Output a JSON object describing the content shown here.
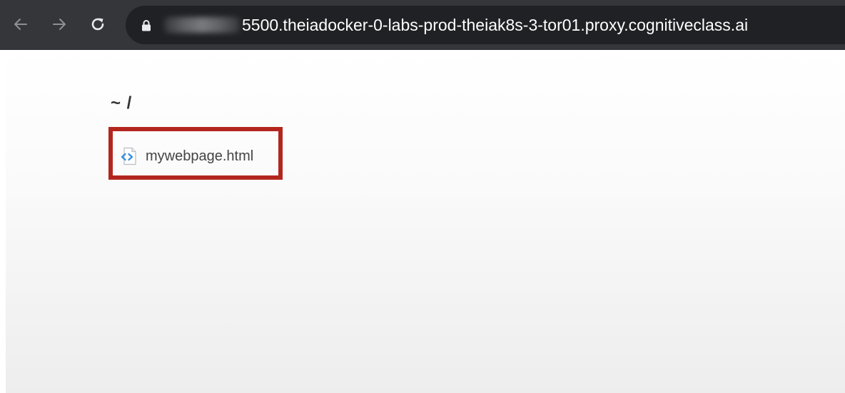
{
  "browser": {
    "url_visible": "5500.theiadocker-0-labs-prod-theiak8s-3-tor01.proxy.cognitiveclass.ai",
    "icons": {
      "back": "back-arrow-icon",
      "forward": "forward-arrow-icon",
      "reload": "reload-icon",
      "lock": "lock-icon"
    }
  },
  "page": {
    "path_title": "~ /",
    "files": [
      {
        "name": "mywebpage.html",
        "icon": "html-file-icon"
      }
    ]
  },
  "colors": {
    "toolbar": "#35363a",
    "omnibox": "#202124",
    "highlight": "#b3261e"
  }
}
